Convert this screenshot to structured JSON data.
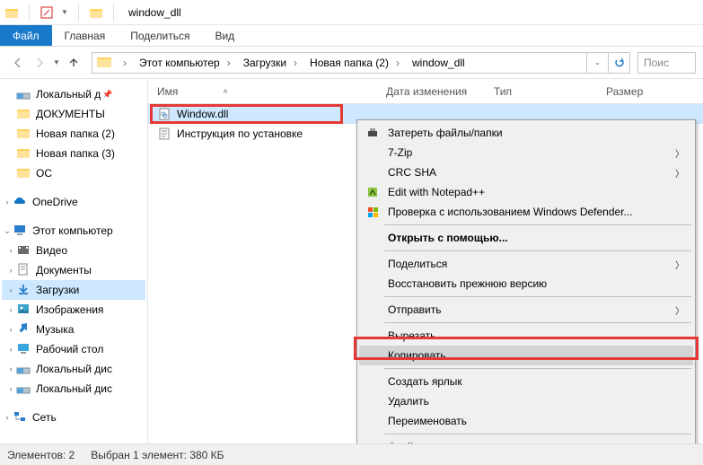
{
  "title": "window_dll",
  "ribbon": {
    "file": "Файл",
    "home": "Главная",
    "share": "Поделиться",
    "view": "Вид"
  },
  "breadcrumb": [
    "Этот компьютер",
    "Загрузки",
    "Новая папка (2)",
    "window_dll"
  ],
  "search_placeholder": "Поис",
  "columns": {
    "name": "Имя",
    "date": "Дата изменения",
    "type": "Тип",
    "size": "Размер"
  },
  "files": [
    {
      "name": "Window.dll"
    },
    {
      "name": "Инструкция по установке"
    }
  ],
  "sidebar": {
    "local_pin": "Локальный д",
    "docs": "ДОКУМЕНТЫ",
    "np2": "Новая папка (2)",
    "np3": "Новая папка (3)",
    "os": "ОС",
    "onedrive": "OneDrive",
    "thispc": "Этот компьютер",
    "video": "Видео",
    "documents": "Документы",
    "downloads": "Загрузки",
    "pictures": "Изображения",
    "music": "Музыка",
    "desktop": "Рабочий стол",
    "localdisk1": "Локальный дис",
    "localdisk2": "Локальный дис",
    "network": "Сеть"
  },
  "ctx": {
    "erase": "Затереть файлы/папки",
    "sevenzip": "7-Zip",
    "crcsha": "CRC SHA",
    "notepadpp": "Edit with Notepad++",
    "defender": "Проверка с использованием Windows Defender...",
    "openwith": "Открыть с помощью...",
    "share": "Поделиться",
    "restoreprev": "Восстановить прежнюю версию",
    "sendto": "Отправить",
    "cut": "Вырезать",
    "copy": "Копировать",
    "shortcut": "Создать ярлык",
    "delete": "Удалить",
    "rename": "Переименовать",
    "props": "Свойства"
  },
  "status": {
    "elements": "Элементов: 2",
    "selected": "Выбран 1 элемент: 380 КБ"
  }
}
